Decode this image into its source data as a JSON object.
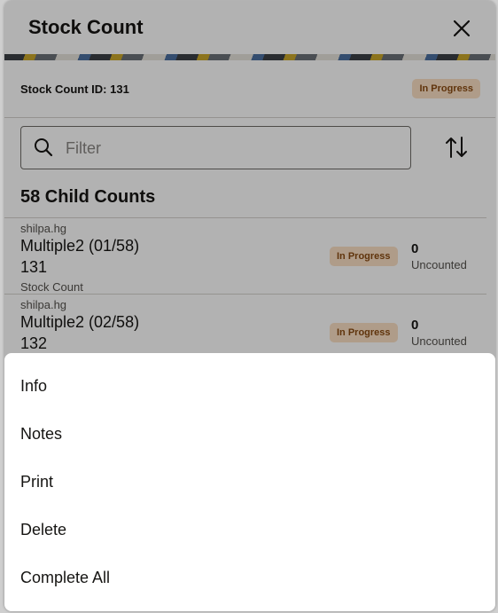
{
  "dialog": {
    "title": "Stock Count",
    "close_icon": "close-icon"
  },
  "summary": {
    "id_label": "Stock Count ID: 131",
    "status": "In Progress"
  },
  "filter": {
    "placeholder": "Filter",
    "search_icon": "search-icon",
    "sort_icon": "sort-icon"
  },
  "child_counts": {
    "heading": "58 Child Counts",
    "rows": [
      {
        "user": "shilpa.hg",
        "name": "Multiple2 (01/58)",
        "number": "131",
        "type": "Stock Count",
        "status": "In Progress",
        "count": "0",
        "count_label": "Uncounted"
      },
      {
        "user": "shilpa.hg",
        "name": "Multiple2 (02/58)",
        "number": "132",
        "type": "",
        "status": "In Progress",
        "count": "0",
        "count_label": "Uncounted"
      }
    ]
  },
  "action_sheet": {
    "items": [
      "Info",
      "Notes",
      "Print",
      "Delete",
      "Complete All"
    ]
  },
  "colors": {
    "badge_bg": "#fbe0c4",
    "badge_text": "#8a4b12",
    "overlay": "rgba(0,0,0,0.30)"
  }
}
